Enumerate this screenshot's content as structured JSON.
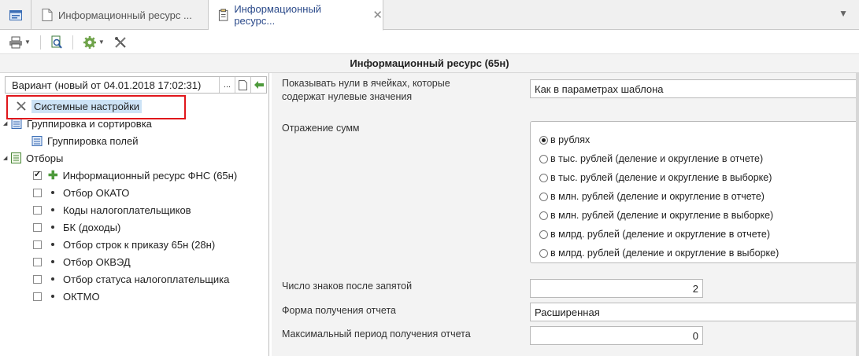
{
  "tabs": [
    {
      "label": "Информационный ресурс ...",
      "active": false
    },
    {
      "label": "Информационный ресурс...",
      "active": true
    }
  ],
  "title": "Информационный ресурс (65н)",
  "variant": {
    "text": "Вариант (новый от 04.01.2018 17:02:31)",
    "more_btn": "..."
  },
  "tree": {
    "system": "Системные настройки",
    "grouping": "Группировка и сортировка",
    "grouping_fields": "Группировка полей",
    "filters": "Отборы",
    "filter_items": [
      {
        "label": "Информационный ресурс ФНС (65н)",
        "checked": true
      },
      {
        "label": "Отбор ОКАТО",
        "checked": false
      },
      {
        "label": "Коды налогоплательщиков",
        "checked": false
      },
      {
        "label": "БК (доходы)",
        "checked": false
      },
      {
        "label": "Отбор строк к приказу 65н (28н)",
        "checked": false
      },
      {
        "label": "Отбор ОКВЭД",
        "checked": false
      },
      {
        "label": "Отбор статуса налогоплательщика",
        "checked": false
      },
      {
        "label": "ОКТМО",
        "checked": false
      }
    ]
  },
  "settings": {
    "zeros_label_line1": "Показывать нули в ячейках, которые",
    "zeros_label_line2": "содержат нулевые значения",
    "zeros_value": "Как в параметрах шаблона",
    "sums_label": "Отражение сумм",
    "sums_options": [
      {
        "label": "в рублях",
        "selected": true
      },
      {
        "label": "в тыс. рублей (деление и округление в отчете)",
        "selected": false
      },
      {
        "label": "в тыс. рублей (деление и округление в выборке)",
        "selected": false
      },
      {
        "label": "в млн. рублей (деление и округление в отчете)",
        "selected": false
      },
      {
        "label": "в млн. рублей (деление и округление в выборке)",
        "selected": false
      },
      {
        "label": "в млрд. рублей (деление и округление в отчете)",
        "selected": false
      },
      {
        "label": "в млрд. рублей (деление и округление в выборке)",
        "selected": false
      }
    ],
    "decimals_label": "Число знаков после запятой",
    "decimals_value": "2",
    "form_label": "Форма получения отчета",
    "form_value": "Расширенная",
    "max_period_label": "Максимальный период получения отчета",
    "max_period_value": "0"
  },
  "colors": {
    "highlight": "#e0161b",
    "selection": "#cde3f6",
    "active_tab_text": "#2b4a8a"
  }
}
